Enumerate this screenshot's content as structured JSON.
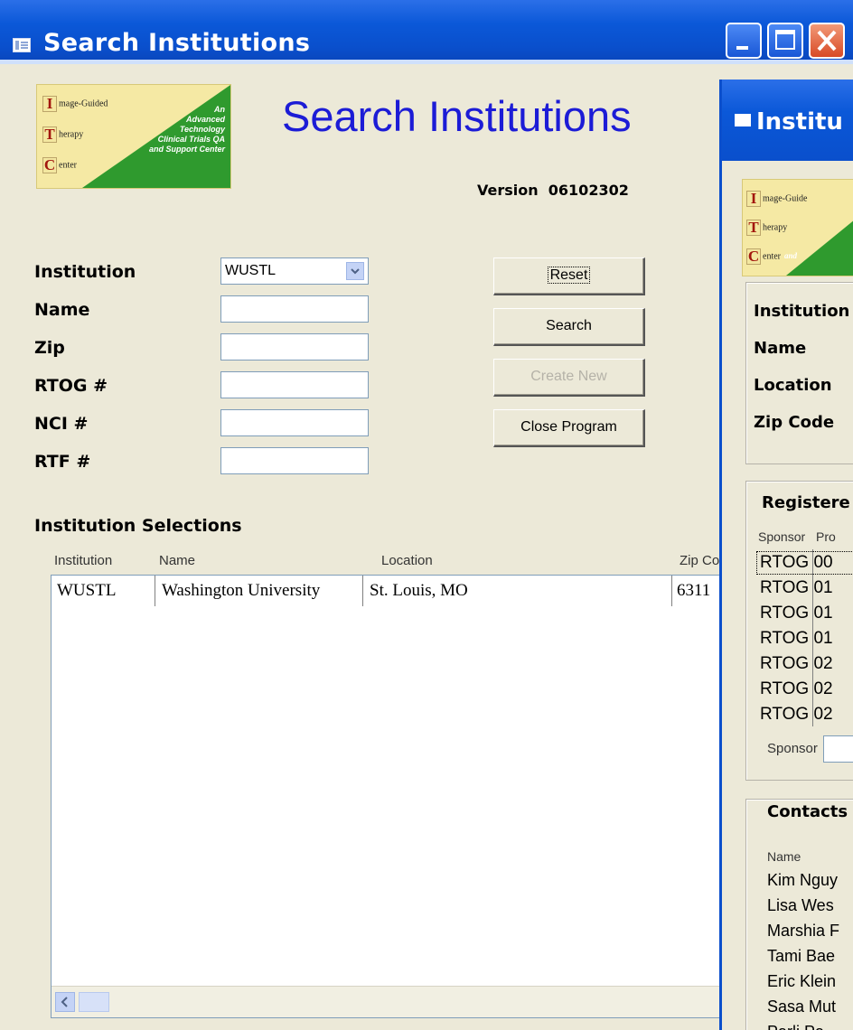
{
  "search_window": {
    "title": "Search Institutions",
    "logo": {
      "line1": "mage-Guided",
      "line2": "herapy",
      "line3": "enter",
      "cap1": "I",
      "cap2": "T",
      "cap3": "C",
      "tagline": [
        "An",
        "Advanced",
        "Technology",
        "Clinical Trials QA",
        "and Support Center"
      ]
    },
    "heading": "Search Institutions",
    "version": "Version  06102302",
    "form": {
      "institution_label": "Institution",
      "institution_value": "WUSTL",
      "name_label": "Name",
      "zip_label": "Zip",
      "rtog_label": "RTOG #",
      "nci_label": "NCI #",
      "rtf_label": "RTF #"
    },
    "buttons": {
      "reset": "Reset",
      "search": "Search",
      "create_new": "Create New",
      "close_program": "Close Program"
    },
    "selections": {
      "title": "Institution Selections",
      "columns": [
        "Institution",
        "Name",
        "Location",
        "Zip Co"
      ],
      "rows": [
        [
          "WUSTL",
          "Washington University",
          "St. Louis, MO",
          "6311"
        ]
      ]
    }
  },
  "detail_window": {
    "title": "Institu",
    "logo": {
      "line1": "mage-Guide",
      "line2": "herapy",
      "line3": "enter",
      "cap1": "I",
      "cap2": "T",
      "cap3": "C",
      "tag": "and"
    },
    "fields": [
      "Institution",
      "Name",
      "Location",
      "Zip Code"
    ],
    "registered": {
      "title": "Registere",
      "columns": [
        "Sponsor",
        "Pro"
      ],
      "rows": [
        [
          "RTOG",
          "00"
        ],
        [
          "RTOG",
          "01"
        ],
        [
          "RTOG",
          "01"
        ],
        [
          "RTOG",
          "01"
        ],
        [
          "RTOG",
          "02"
        ],
        [
          "RTOG",
          "02"
        ],
        [
          "RTOG",
          "02"
        ]
      ],
      "filter_label": "Sponsor"
    },
    "contacts": {
      "title": "Contacts",
      "column": "Name",
      "rows": [
        "Kim Nguy",
        "Lisa Wes",
        "Marshia F",
        "Tami Bae",
        "Eric Klein",
        "Sasa Mut",
        "Parli Pa"
      ]
    }
  },
  "colors": {
    "titlebar": "#0a52d0",
    "window_bg": "#ece9d8",
    "heading_blue": "#1c1cd6",
    "desktop": "#1f3f9a"
  }
}
